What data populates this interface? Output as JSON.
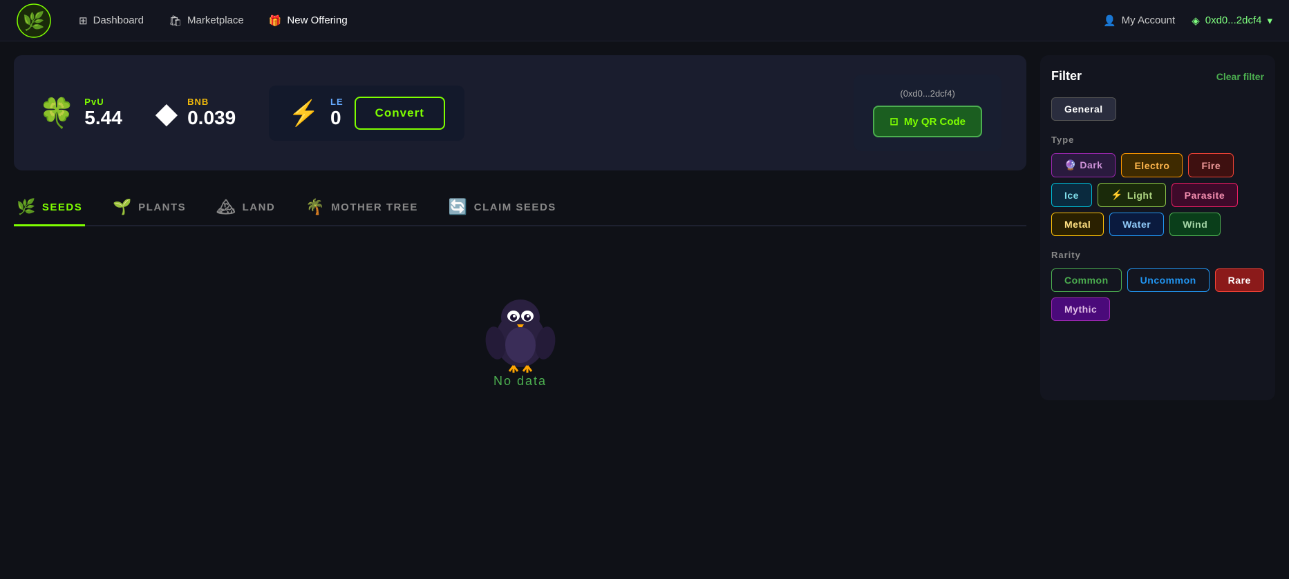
{
  "navbar": {
    "logo_alt": "Plant vs Undead",
    "links": [
      {
        "label": "Dashboard",
        "icon": "⊞",
        "active": false
      },
      {
        "label": "Marketplace",
        "icon": "🛍",
        "active": false
      },
      {
        "label": "New Offering",
        "icon": "🎁",
        "active": true
      }
    ],
    "account_label": "My Account",
    "wallet_label": "0xd0...2dcf4",
    "wallet_icon": "◈"
  },
  "balance": {
    "pvu_label": "PvU",
    "pvu_value": "5.44",
    "bnb_label": "BNB",
    "bnb_value": "0.039",
    "le_label": "LE",
    "le_value": "0",
    "convert_label": "Convert",
    "qr_address": "(0xd0...2dcf4)",
    "qr_btn_label": "My QR Code"
  },
  "tabs": [
    {
      "label": "SEEDS",
      "icon": "🌿",
      "active": true
    },
    {
      "label": "PLANTS",
      "icon": "🌱",
      "active": false
    },
    {
      "label": "LAND",
      "icon": "🏔",
      "active": false
    },
    {
      "label": "MOTHER TREE",
      "icon": "🌴",
      "active": false
    },
    {
      "label": "CLAIM SEEDS",
      "icon": "🔄",
      "active": false
    }
  ],
  "no_data": {
    "text": "No data"
  },
  "filter": {
    "title": "Filter",
    "clear_label": "Clear filter",
    "general_label": "General",
    "type_label": "Type",
    "types": [
      {
        "label": "Dark",
        "class": "dark"
      },
      {
        "label": "Electro",
        "class": "electro"
      },
      {
        "label": "Fire",
        "class": "fire"
      },
      {
        "label": "Ice",
        "class": "ice"
      },
      {
        "label": "Light",
        "class": "light"
      },
      {
        "label": "Parasite",
        "class": "parasite"
      },
      {
        "label": "Metal",
        "class": "metal"
      },
      {
        "label": "Water",
        "class": "water"
      },
      {
        "label": "Wind",
        "class": "wind"
      }
    ],
    "rarity_label": "Rarity",
    "rarities": [
      {
        "label": "Common",
        "class": "common"
      },
      {
        "label": "Uncommon",
        "class": "uncommon"
      },
      {
        "label": "Rare",
        "class": "rare"
      },
      {
        "label": "Mythic",
        "class": "mythic"
      }
    ]
  }
}
